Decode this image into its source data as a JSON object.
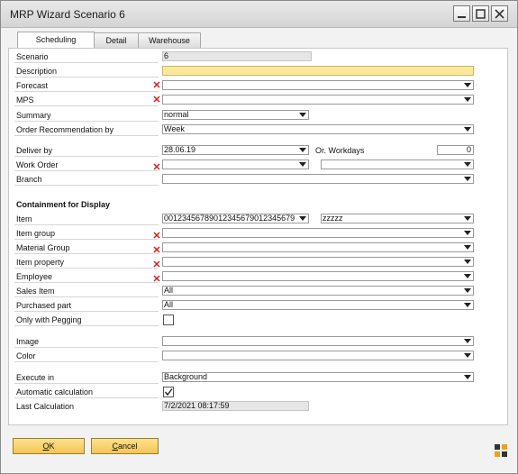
{
  "window": {
    "title": "MRP Wizard Scenario 6"
  },
  "tabs": [
    {
      "label": "Scheduling",
      "active": true
    },
    {
      "label": "Detail"
    },
    {
      "label": "Warehouse"
    }
  ],
  "form": {
    "scenario": {
      "label": "Scenario",
      "value": "6"
    },
    "description": {
      "label": "Description",
      "value": ""
    },
    "forecast": {
      "label": "Forecast",
      "value": ""
    },
    "mps": {
      "label": "MPS",
      "value": ""
    },
    "summary": {
      "label": "Summary",
      "value": "normal"
    },
    "order_recommendation": {
      "label": "Order Recommendation by",
      "value": "Week"
    },
    "deliver_by": {
      "label": "Deliver by",
      "value": "28.06.19"
    },
    "or_workdays": {
      "label": "Or. Workdays",
      "value": "0"
    },
    "work_order": {
      "label": "Work Order",
      "value": "",
      "value2": ""
    },
    "branch": {
      "label": "Branch",
      "value": ""
    },
    "containment_heading": "Containment for Display",
    "item": {
      "label": "Item",
      "value": "00123456789012345679012345679",
      "value2": "zzzzz"
    },
    "item_group": {
      "label": "Item group",
      "value": ""
    },
    "material_group": {
      "label": "Material Group",
      "value": ""
    },
    "item_property": {
      "label": "Item property",
      "value": ""
    },
    "employee": {
      "label": "Employee",
      "value": ""
    },
    "sales_item": {
      "label": "Sales Item",
      "value": "All"
    },
    "purchased_part": {
      "label": "Purchased part",
      "value": "All"
    },
    "only_with_pegging": {
      "label": "Only with Pegging",
      "checked": false
    },
    "image": {
      "label": "Image",
      "value": ""
    },
    "color": {
      "label": "Color",
      "value": ""
    },
    "execute_in": {
      "label": "Execute in",
      "value": "Background"
    },
    "automatic_calculation": {
      "label": "Automatic calculation",
      "checked": true
    },
    "last_calculation": {
      "label": "Last Calculation",
      "value": "7/2/2021 08:17:59"
    }
  },
  "buttons": {
    "ok": "OK",
    "cancel": "Cancel"
  },
  "colors": {
    "button_fill": "#f3c655",
    "description_fill": "#fde89a",
    "required_mark": "#d21f1f"
  }
}
